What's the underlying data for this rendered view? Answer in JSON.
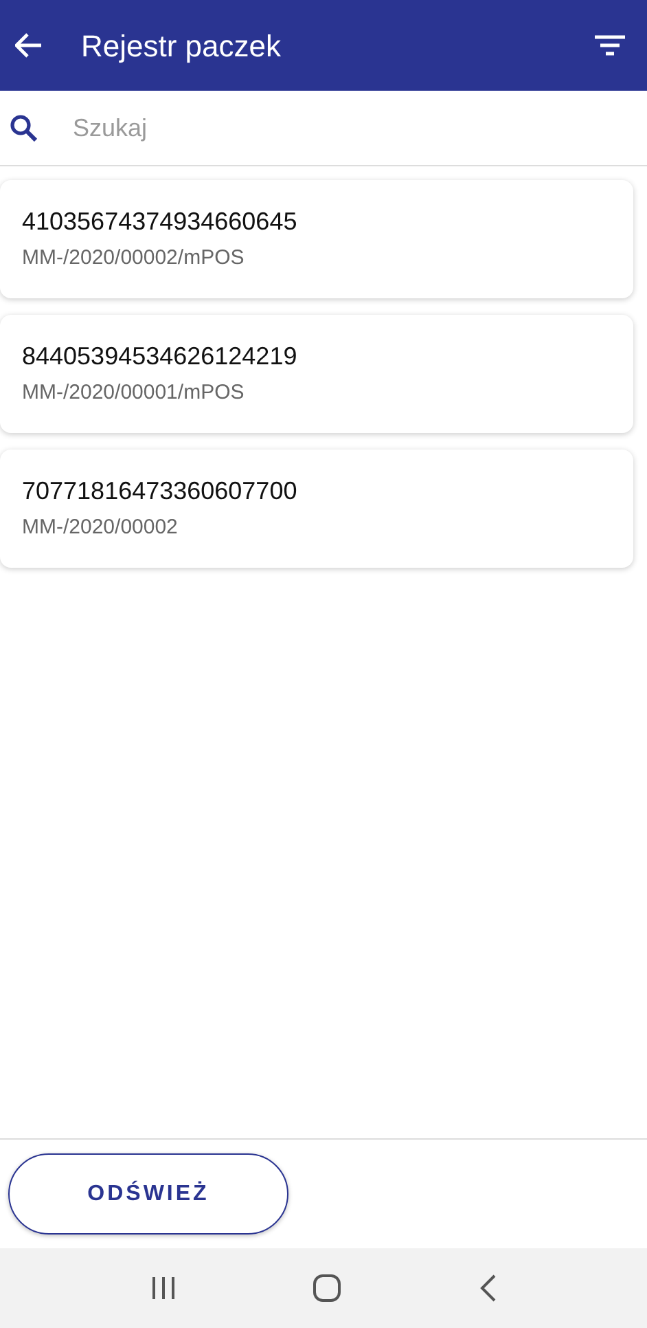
{
  "header": {
    "title": "Rejestr paczek"
  },
  "search": {
    "placeholder": "Szukaj"
  },
  "parcels": [
    {
      "number": "41035674374934660645",
      "document": "MM-/2020/00002/mPOS"
    },
    {
      "number": "84405394534626124219",
      "document": "MM-/2020/00001/mPOS"
    },
    {
      "number": "70771816473360607700",
      "document": "MM-/2020/00002"
    }
  ],
  "footer": {
    "refresh_button": "ODŚWIEŻ"
  }
}
